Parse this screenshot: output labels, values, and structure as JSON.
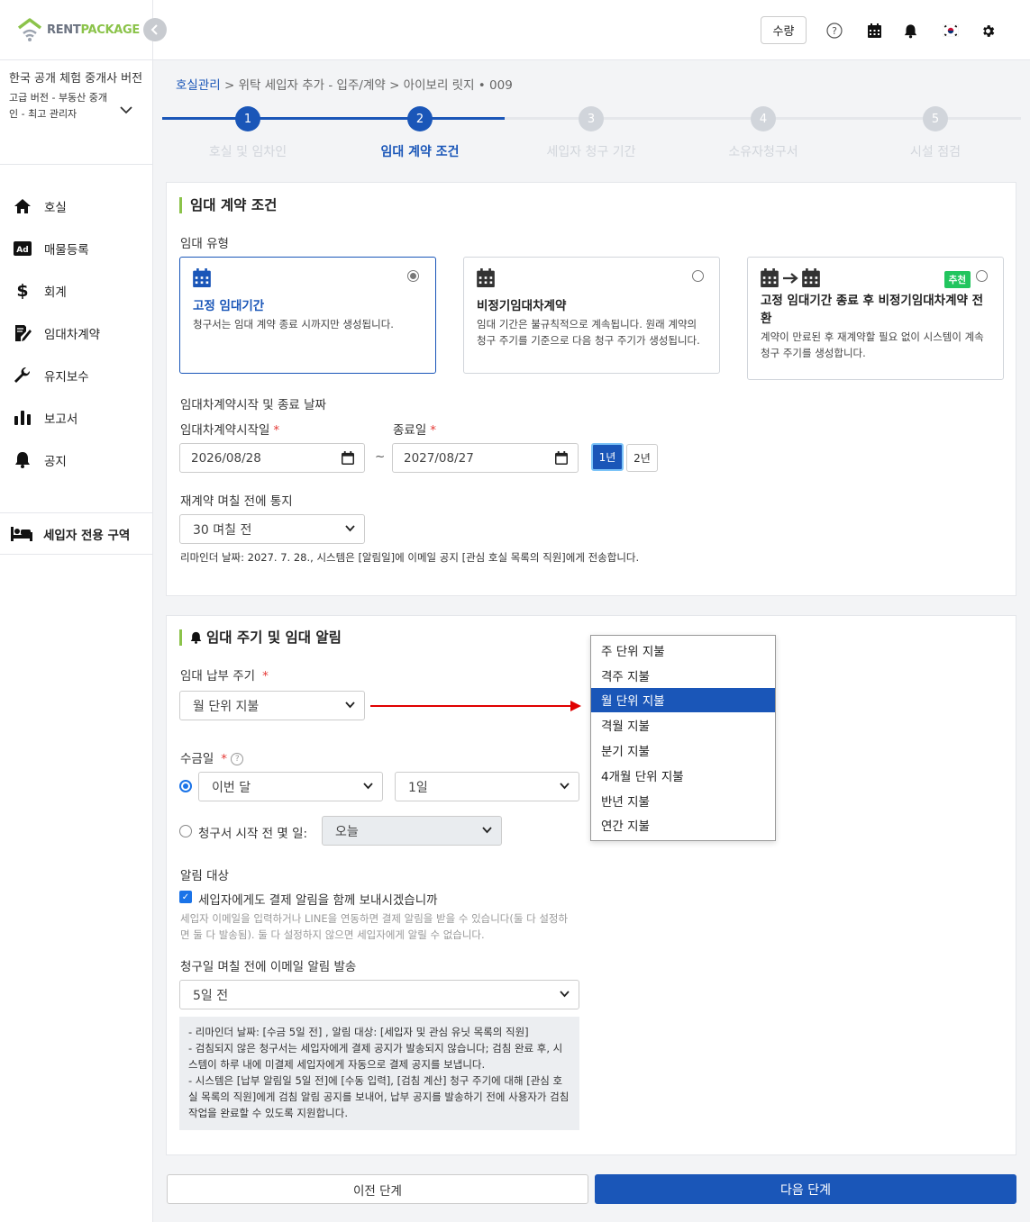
{
  "app": {
    "logo_rent": "RENT",
    "logo_package": "PACKAGE"
  },
  "company": {
    "name": "한국 공개 체험 중개사 버전",
    "plan": "고급 버전 - 부동산 중개인 - 최고 관리자"
  },
  "sidebar": {
    "items": [
      {
        "label": "호실",
        "icon": "home-icon"
      },
      {
        "label": "매물등록",
        "icon": "ad-icon"
      },
      {
        "label": "회계",
        "icon": "dollar-icon"
      },
      {
        "label": "임대차계약",
        "icon": "contract-icon"
      },
      {
        "label": "유지보수",
        "icon": "wrench-icon"
      },
      {
        "label": "보고서",
        "icon": "chart-icon"
      },
      {
        "label": "공지",
        "icon": "bell-icon"
      }
    ],
    "tenant_zone": "세입자 전용 구역"
  },
  "topbar": {
    "qty_label": "수량"
  },
  "breadcrumb": {
    "root": "호실관리",
    "rest": " > 위탁 세입자 추가 - 입주/계약 > 아이보리 릿지 • 009"
  },
  "stepper": {
    "steps": [
      {
        "num": "1",
        "label": "호실 및 임차인",
        "state": "done"
      },
      {
        "num": "2",
        "label": "임대 계약 조건",
        "state": "active"
      },
      {
        "num": "3",
        "label": "세입자 청구 기간",
        "state": "todo"
      },
      {
        "num": "4",
        "label": "소유자청구서",
        "state": "todo"
      },
      {
        "num": "5",
        "label": "시설 점검",
        "state": "todo"
      }
    ]
  },
  "lease_section": {
    "title": "임대 계약 조건",
    "type_label": "임대 유형",
    "options": [
      {
        "title": "고정 임대기간",
        "desc": "청구서는 임대 계약 종료 시까지만 생성됩니다.",
        "selected": true
      },
      {
        "title": "비정기임대차계약",
        "desc": "임대 기간은 불규칙적으로 계속됩니다. 원래 계약의 청구 주기를 기준으로 다음 청구 주기가 생성됩니다.",
        "selected": false
      },
      {
        "title": "고정 임대기간 종료 후 비정기임대차계약 전환",
        "desc": "계약이 만료된 후 재계약할 필요 없이 시스템이 계속 청구 주기를 생성합니다.",
        "selected": false,
        "badge": "추천"
      }
    ],
    "date_heading": "임대차계약시작 및 종료 날짜",
    "start_label": "임대차계약시작일",
    "end_label": "종료일",
    "start_value": "2026/08/28",
    "end_value": "2027/08/27",
    "tilde": "~",
    "year_buttons": [
      "1년",
      "2년"
    ],
    "renewal_label": "재계약 며칠 전에 통지",
    "renewal_value": "30 며칠 전",
    "reminder_note": "리마인더 날짜: 2027. 7. 28., 시스템은 [알림일]에 이메일 공지 [관심 호실 목록의 직원]에게 전송합니다."
  },
  "cycle_section": {
    "title": "임대 주기 및 임대 알림",
    "payment_cycle_label": "임대 납부 주기",
    "payment_cycle_value": "월 단위 지불",
    "collection_label": "수금일",
    "month_value": "이번 달",
    "day_value": "1일",
    "before_label": "청구서 시작 전 몇 일:",
    "before_value": "오늘",
    "notify_label": "알림 대상",
    "notify_check": "세입자에게도 결제 알림을 함께 보내시겠습니까",
    "notify_note": "세입자 이메일을 입력하거나 LINE을 연동하면 결제 알림을 받을 수 있습니다(둘 다 설정하면 둘 다 발송됨). 둘 다 설정하지 않으면 세입자에게 알릴 수 없습니다.",
    "email_label": "청구일 며칠 전에 이메일 알림 발송",
    "email_value": "5일 전",
    "info_lines": [
      "- 리마인더 날짜: [수금 5일 전] , 알림 대상: [세입자 및 관심 유닛 목록의 직원]",
      "- 검침되지 않은 청구서는 세입자에게 결제 공지가 발송되지 않습니다; 검침 완료 후, 시스템이 하루 내에 미결제 세입자에게 자동으로 결제 공지를 보냅니다.",
      "- 시스템은 [납부 알림일 5일 전]에 [수동 입력], [검침 계산] 청구 주기에 대해 [관심 호실 목록의 직원]에게 검침 알림 공지를 보내어, 납부 공지를 발송하기 전에 사용자가 검침 작업을 완료할 수 있도록 지원합니다."
    ]
  },
  "dropdown": {
    "options": [
      "주 단위 지불",
      "격주 지불",
      "월 단위 지불",
      "격월 지불",
      "분기 지불",
      "4개월 단위 지불",
      "반년 지불",
      "연간 지불"
    ],
    "selected": "월 단위 지불"
  },
  "footer": {
    "prev_label": "이전 단계",
    "next_label": "다음 단계"
  },
  "colors": {
    "primary": "#1a56b8",
    "accent_green": "#8bc34a",
    "arrow_red": "#e00000"
  }
}
